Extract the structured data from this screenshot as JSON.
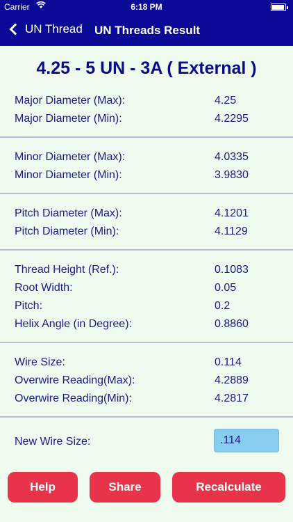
{
  "status_bar": {
    "carrier": "Carrier",
    "time": "6:18 PM"
  },
  "nav": {
    "back_label": "UN Thread",
    "title": "UN Threads Result"
  },
  "heading": "4.25 - 5 UN - 3A ( External )",
  "groups": [
    [
      {
        "label": "Major Diameter (Max):",
        "value": "4.25"
      },
      {
        "label": "Major Diameter (Min):",
        "value": "4.2295"
      }
    ],
    [
      {
        "label": "Minor Diameter (Max):",
        "value": "4.0335"
      },
      {
        "label": "Minor Diameter (Min):",
        "value": "3.9830"
      }
    ],
    [
      {
        "label": "Pitch Diameter (Max):",
        "value": "4.1201"
      },
      {
        "label": "Pitch Diameter (Min):",
        "value": "4.1129"
      }
    ],
    [
      {
        "label": "Thread Height (Ref.):",
        "value": "0.1083"
      },
      {
        "label": "Root Width:",
        "value": "0.05"
      },
      {
        "label": "Pitch:",
        "value": "0.2"
      },
      {
        "label": "Helix Angle (in Degree):",
        "value": "0.8860"
      }
    ],
    [
      {
        "label": "Wire Size:",
        "value": "0.114"
      },
      {
        "label": "Overwire Reading(Max):",
        "value": "4.2889"
      },
      {
        "label": "Overwire Reading(Min):",
        "value": "4.2817"
      }
    ]
  ],
  "new_wire": {
    "label": "New Wire Size:",
    "value": ".114"
  },
  "buttons": {
    "help": "Help",
    "share": "Share",
    "recalculate": "Recalculate"
  },
  "colors": {
    "nav_bg": "#0a0a96",
    "page_bg": "#eefbee",
    "text": "#1a1a8c",
    "button": "#e8344a",
    "input_bg": "#86cdee"
  }
}
